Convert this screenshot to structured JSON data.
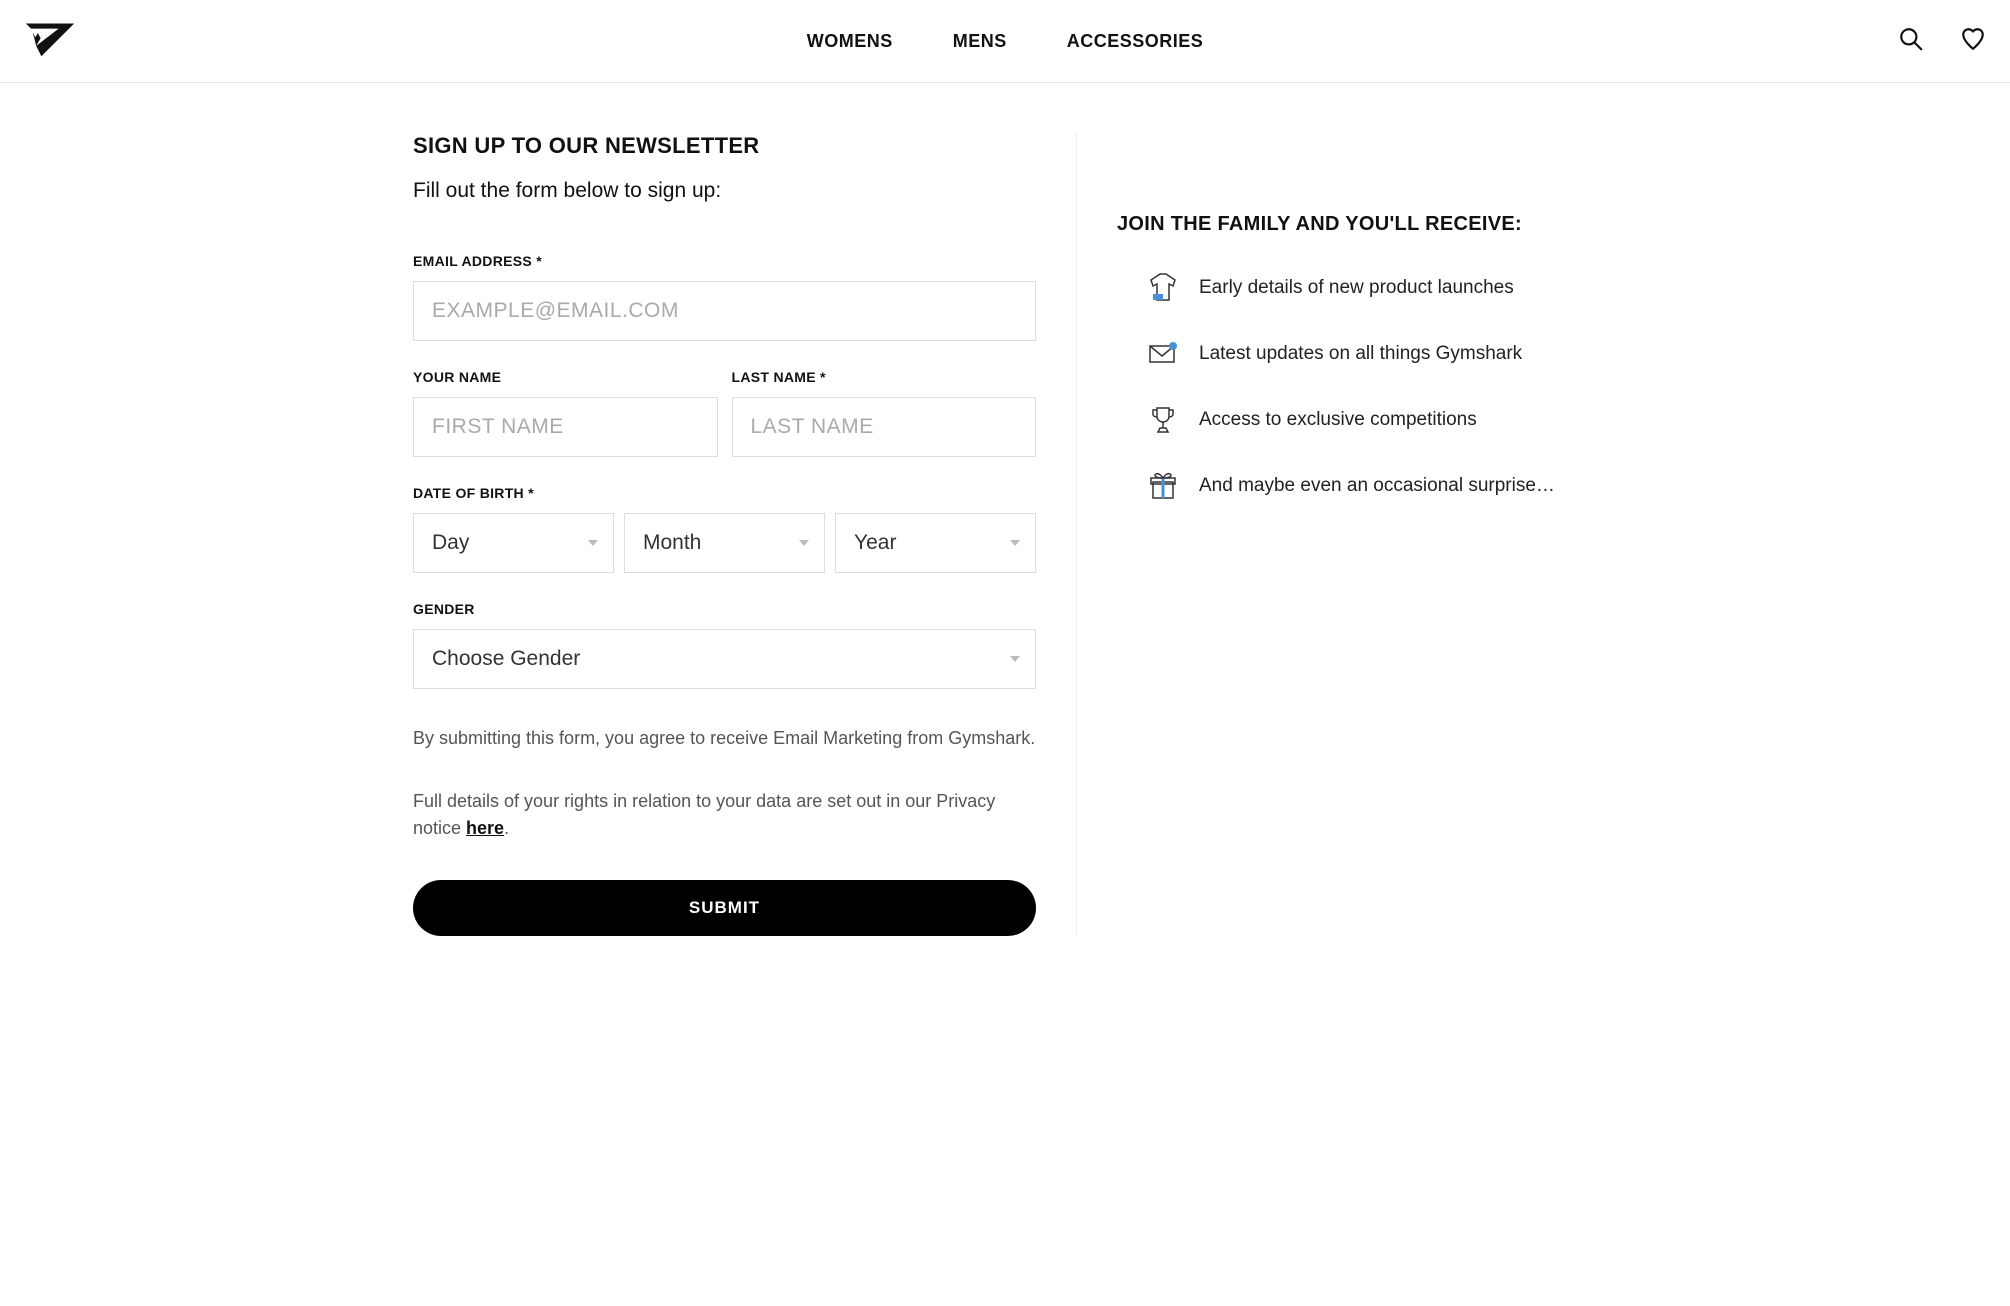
{
  "nav": {
    "items": [
      "WOMENS",
      "MENS",
      "ACCESSORIES"
    ]
  },
  "form": {
    "title": "SIGN UP TO OUR NEWSLETTER",
    "subtitle": "Fill out the form below to sign up:",
    "email_label": "EMAIL ADDRESS *",
    "email_placeholder": "EXAMPLE@EMAIL.COM",
    "firstname_label": "YOUR NAME",
    "firstname_placeholder": "FIRST NAME",
    "lastname_label": "LAST NAME *",
    "lastname_placeholder": "LAST NAME",
    "dob_label": "DATE OF BIRTH *",
    "dob_day": "Day",
    "dob_month": "Month",
    "dob_year": "Year",
    "gender_label": "GENDER",
    "gender_placeholder": "Choose Gender",
    "disclaimer1": "By submitting this form, you agree to receive Email Marketing from Gymshark.",
    "disclaimer2_pre": "Full details of your rights in relation to your data are set out in our Privacy notice ",
    "disclaimer2_link": "here",
    "disclaimer2_post": ".",
    "submit": "SUBMIT"
  },
  "info": {
    "title": "JOIN THE FAMILY AND YOU'LL RECEIVE:",
    "benefits": [
      "Early details of new product launches",
      "Latest updates on all things Gymshark",
      "Access to exclusive competitions",
      "And maybe even an occasional surprise…"
    ]
  }
}
